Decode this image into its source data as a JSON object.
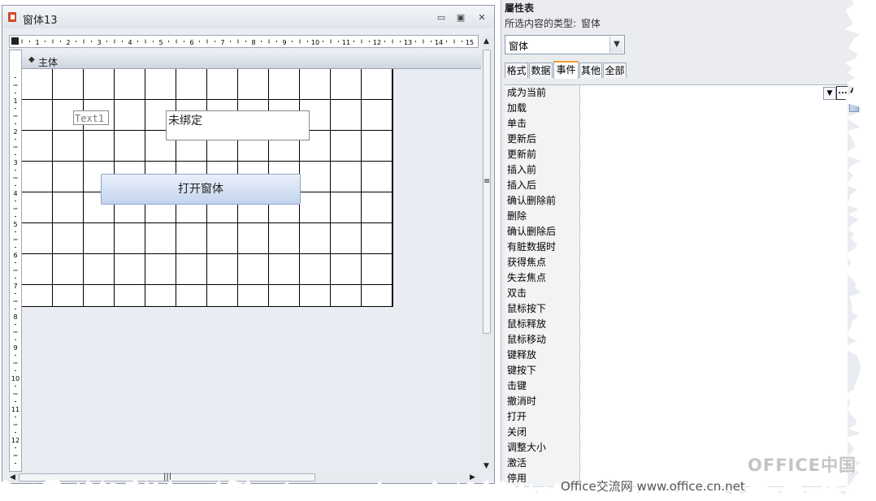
{
  "form_window": {
    "title": "窗体13",
    "minimize": "▭",
    "restore": "▣",
    "close": "✕",
    "section_label": "主体",
    "controls": {
      "text1_label": "Text1",
      "unbound_text": "未绑定",
      "open_form_button": "打开窗体"
    },
    "ruler_h_labels": [
      "1",
      "2",
      "3",
      "4",
      "5",
      "6",
      "7",
      "8",
      "9",
      "10",
      "11",
      "12",
      "13",
      "14",
      "15"
    ],
    "ruler_v_labels": [
      "1",
      "2",
      "3",
      "4",
      "5",
      "6",
      "7",
      "8",
      "9",
      "10",
      "11",
      "12"
    ]
  },
  "property_sheet": {
    "title": "屬性表",
    "selection_type_label": "所选内容的类型:",
    "selection_type_value": "窗体",
    "object_selector_value": "窗体",
    "tabs": [
      {
        "label": "格式",
        "active": false
      },
      {
        "label": "数据",
        "active": false
      },
      {
        "label": "事件",
        "active": true
      },
      {
        "label": "其他",
        "active": false
      },
      {
        "label": "全部",
        "active": false
      }
    ],
    "properties": [
      "成为当前",
      "加载",
      "单击",
      "更新后",
      "更新前",
      "插入前",
      "插入后",
      "确认删除前",
      "删除",
      "确认删除后",
      "有脏数据时",
      "获得焦点",
      "失去焦点",
      "双击",
      "鼠标按下",
      "鼠标释放",
      "鼠标移动",
      "键释放",
      "键按下",
      "击键",
      "撤消时",
      "打开",
      "关闭",
      "调整大小",
      "激活",
      "停用"
    ],
    "builder_button": "..."
  },
  "watermarks": {
    "brand": "OFFICE中国",
    "site": "Office交流网 www.office.cn.net"
  }
}
